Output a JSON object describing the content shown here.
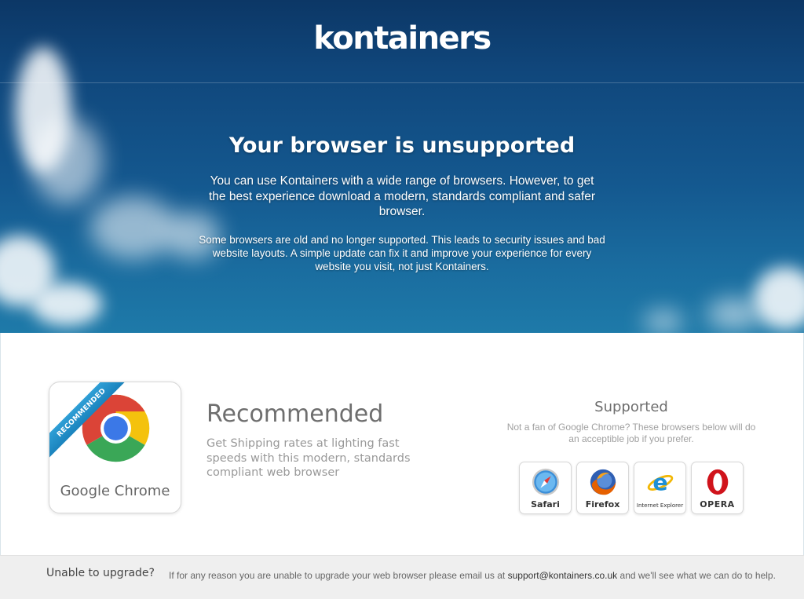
{
  "header": {
    "logo_text": "kontainers"
  },
  "hero": {
    "title": "Your browser is unsupported",
    "paragraph1": "You can use Kontainers with a wide range of browsers. However, to get the best experience download a modern, standards compliant and safer browser.",
    "paragraph2": "Some browsers are old and no longer supported. This leads to security issues and bad website layouts. A simple update can fix it and improve your experience for every website you visit, not just Kontainers."
  },
  "recommended": {
    "ribbon": "RECOMMENDED",
    "browser_name": "Google Chrome",
    "icon": "chrome-icon",
    "title": "Recommended",
    "description": "Get Shipping rates at lighting fast speeds with this modern, standards compliant web browser"
  },
  "supported": {
    "title": "Supported",
    "description": "Not a fan of Google Chrome? These browsers below will do an acceptible job if you prefer.",
    "browsers": [
      {
        "label": "Safari",
        "icon": "safari-icon"
      },
      {
        "label": "Firefox",
        "icon": "firefox-icon"
      },
      {
        "label": "Internet Explorer",
        "icon": "internet-explorer-icon"
      },
      {
        "label": "OPERA",
        "icon": "opera-icon"
      }
    ]
  },
  "footer": {
    "question": "Unable to upgrade?",
    "message_before": "If for any reason you are unable to upgrade your web browser please email us at ",
    "email": "support@kontainers.co.uk",
    "message_after": " and we'll see what we can do to help."
  },
  "colors": {
    "sky_top": "#0c3766",
    "sky_bottom": "#1e7aa9",
    "ribbon": "#2f9fd6",
    "footer_bg": "#efefef"
  }
}
